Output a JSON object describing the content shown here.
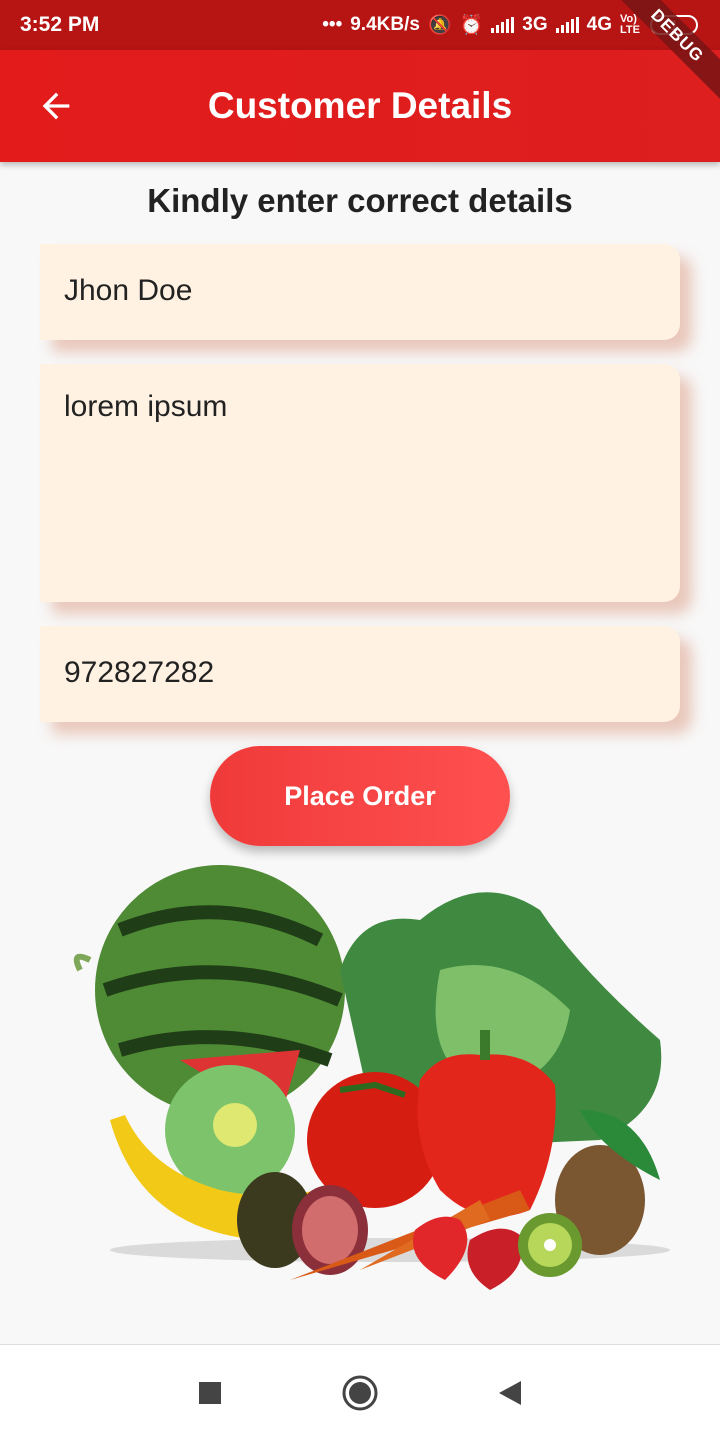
{
  "status_bar": {
    "time": "3:52 PM",
    "network_speed": "9.4KB/s",
    "network_1": "3G",
    "network_2": "4G",
    "volte": "Vo) LTE",
    "battery": "1"
  },
  "debug_banner": "DEBUG",
  "app_bar": {
    "title": "Customer Details",
    "back_icon": "arrow-left-icon"
  },
  "form": {
    "heading": "Kindly enter correct details",
    "name_value": "Jhon Doe",
    "address_value": "lorem ipsum",
    "phone_value": "972827282"
  },
  "place_order_label": "Place Order",
  "nav": {
    "recents_icon": "square-icon",
    "home_icon": "circle-icon",
    "back_icon": "triangle-back-icon"
  },
  "colors": {
    "app_bar": "#e31b1b",
    "field_bg": "#fff2e2",
    "button": "#f03a3a"
  }
}
